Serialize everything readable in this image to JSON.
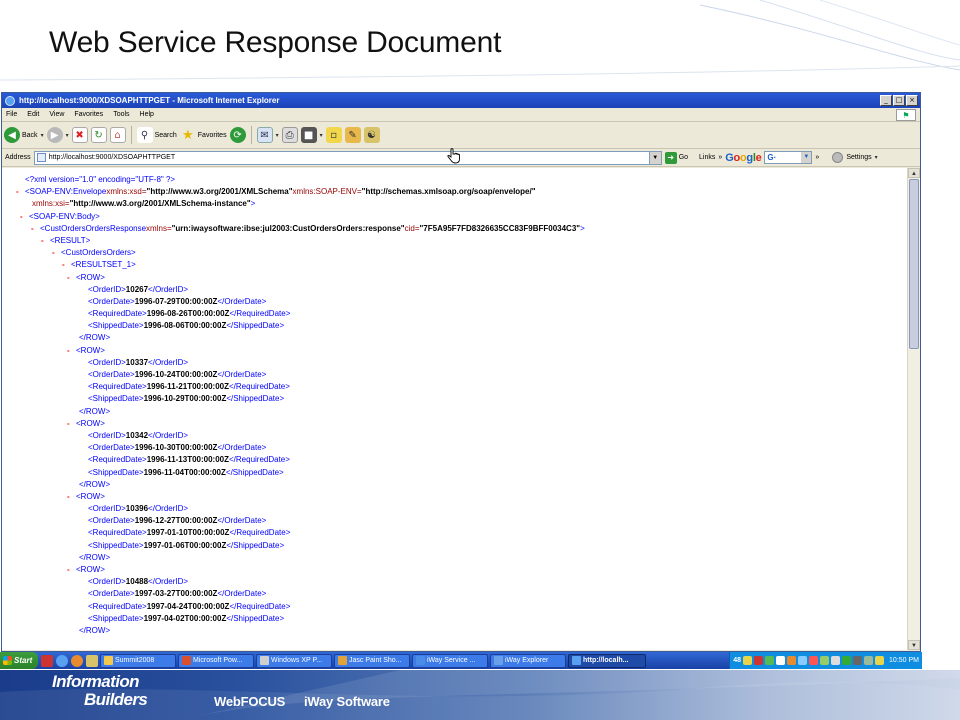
{
  "slide": {
    "title": "Web Service Response Document"
  },
  "browser": {
    "window_title": "http://localhost:9000/XDSOAPHTTPGET - Microsoft Internet Explorer",
    "window_buttons": [
      "_",
      "□",
      "×"
    ],
    "menu": [
      "File",
      "Edit",
      "View",
      "Favorites",
      "Tools",
      "Help"
    ],
    "toolbar": {
      "back": "Back",
      "search": "Search",
      "favorites": "Favorites"
    },
    "address": {
      "label": "Address",
      "url": "http://localhost:9000/XDSOAPHTTPGET",
      "go": "Go",
      "links": "Links",
      "chevron": "»",
      "google": "Google",
      "google_box": "G·",
      "settings": "Settings"
    }
  },
  "xml": {
    "declaration": "<?xml version=\"1.0\" encoding=\"UTF-8\" ?>",
    "envelope": {
      "tag": "<SOAP-ENV:Envelope",
      "attr1_name": " xmlns:xsd=",
      "attr1_value": "\"http://www.w3.org/2001/XMLSchema\"",
      "attr2_name": " xmlns:SOAP-ENV=",
      "attr2_value": "\"http://schemas.xmlsoap.org/soap/envelope/\"",
      "attr3_name": "xmlns:xsi=",
      "attr3_value": "\"http://www.w3.org/2001/XMLSchema-instance\"",
      "close": ">"
    },
    "body_tag": "<SOAP-ENV:Body>",
    "response": {
      "tag": "<CustOrdersOrdersResponse",
      "attr1_name": " xmlns=",
      "attr1_value": "\"urn:iwaysoftware:ibse:jul2003:CustOrdersOrders:response\"",
      "attr2_name": " cid=",
      "attr2_value": "\"7F5A95F7FD8326635CC83F9BFF0034C3\"",
      "close": ">"
    },
    "result_tag": "<RESULT>",
    "custorders_tag": "<CustOrdersOrders>",
    "resultset_tag": "<RESULTSET_1>",
    "row_open": "<ROW>",
    "row_close": "</ROW>",
    "rows": [
      {
        "order_id": "10267",
        "order_date": "1996-07-29T00:00:00Z",
        "required_date": "1996-08-26T00:00:00Z",
        "shipped_date": "1996-08-06T00:00:00Z"
      },
      {
        "order_id": "10337",
        "order_date": "1996-10-24T00:00:00Z",
        "required_date": "1996-11-21T00:00:00Z",
        "shipped_date": "1996-10-29T00:00:00Z"
      },
      {
        "order_id": "10342",
        "order_date": "1996-10-30T00:00:00Z",
        "required_date": "1996-11-13T00:00:00Z",
        "shipped_date": "1996-11-04T00:00:00Z"
      },
      {
        "order_id": "10396",
        "order_date": "1996-12-27T00:00:00Z",
        "required_date": "1997-01-10T00:00:00Z",
        "shipped_date": "1997-01-06T00:00:00Z"
      },
      {
        "order_id": "10488",
        "order_date": "1997-03-27T00:00:00Z",
        "required_date": "1997-04-24T00:00:00Z",
        "shipped_date": "1997-04-02T00:00:00Z"
      }
    ],
    "fields": {
      "order_id_open": "<OrderID>",
      "order_id_close": "</OrderID>",
      "order_date_open": "<OrderDate>",
      "order_date_close": "</OrderDate>",
      "required_date_open": "<RequiredDate>",
      "required_date_close": "</RequiredDate>",
      "shipped_date_open": "<ShippedDate>",
      "shipped_date_close": "</ShippedDate>"
    },
    "toggle": "-"
  },
  "taskbar": {
    "start": "Start",
    "tasks": [
      {
        "label": "Summit2008",
        "icon_color": "#f2c94c",
        "active": false
      },
      {
        "label": "Microsoft Pow...",
        "icon_color": "#d9502e",
        "active": false
      },
      {
        "label": "Windows XP P...",
        "icon_color": "#cfcfcf",
        "active": false
      },
      {
        "label": "Jasc Paint Sho...",
        "icon_color": "#e2a23a",
        "active": false
      },
      {
        "label": "iWay Service ...",
        "icon_color": "#4a8de8",
        "active": false
      },
      {
        "label": "iWay Explorer",
        "icon_color": "#6aa0e8",
        "active": false
      },
      {
        "label": "http://localh...",
        "icon_color": "#5aa0f0",
        "active": true
      }
    ],
    "tray_text": "48",
    "clock": "10:50 PM"
  },
  "footer": {
    "logo_line1": "Information",
    "logo_line2": "Builders",
    "link1": "WebFOCUS",
    "link2": "iWay Software"
  },
  "colors": {
    "xml_markup": "#0000ff",
    "xml_tag": "#990000",
    "xml_toggle": "#ff0000",
    "titlebar": "#2a5bd7",
    "footer_dark": "#1a3c8a"
  }
}
